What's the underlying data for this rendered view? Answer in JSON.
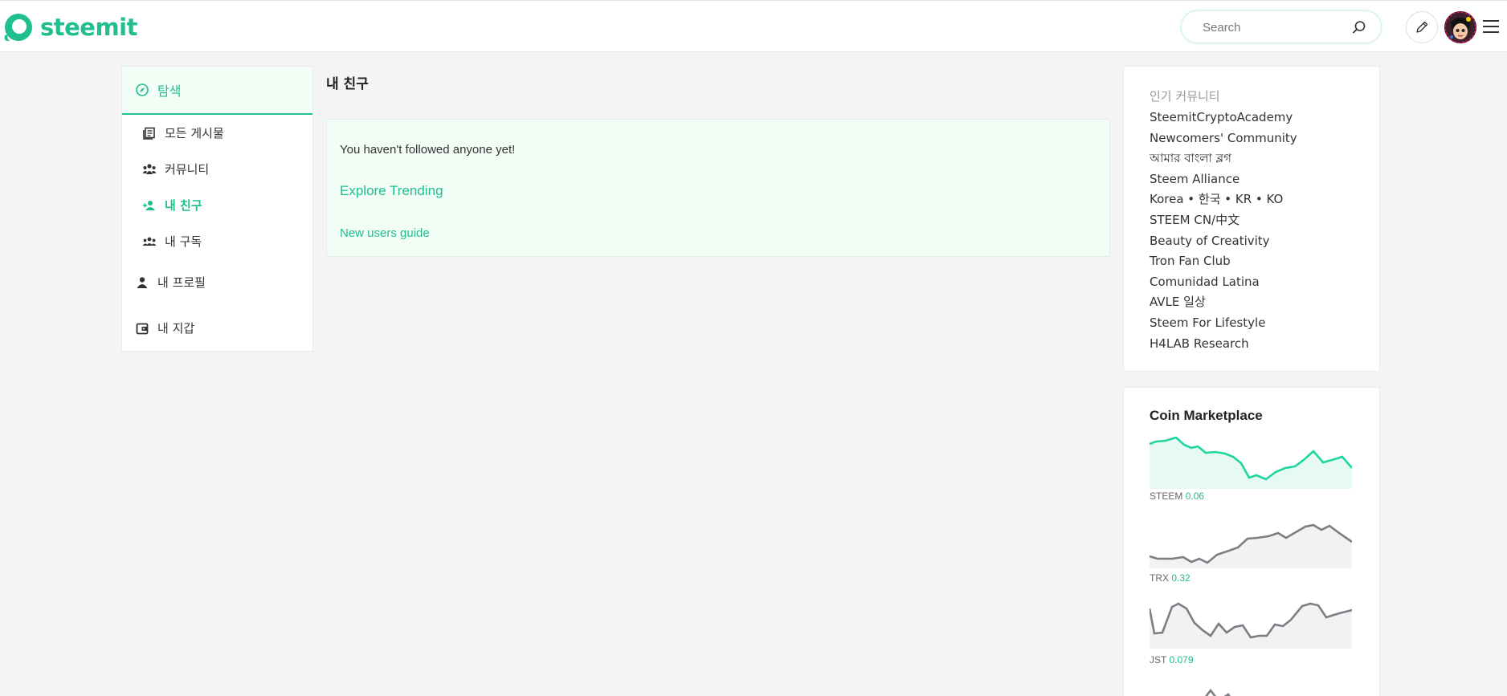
{
  "header": {
    "logo_text": "steemit",
    "search_placeholder": "Search"
  },
  "sidebar": {
    "explore": "탐색",
    "items": [
      {
        "label": "모든 게시물"
      },
      {
        "label": "커뮤니티"
      },
      {
        "label": "내 친구"
      },
      {
        "label": "내 구독"
      }
    ],
    "profile": "내 프로필",
    "wallet": "내 지갑"
  },
  "main": {
    "title": "내 친구",
    "empty_message": "You haven't followed anyone yet!",
    "explore_link": "Explore Trending",
    "guide_link": "New users guide"
  },
  "popular": {
    "heading": "인기 커뮤니티",
    "items": [
      "SteemitCryptoAcademy",
      "Newcomers' Community",
      "আমার বাংলা ব্লগ",
      "Steem Alliance",
      "Korea • 한국 • KR • KO",
      "STEEM CN/中文",
      "Beauty of Creativity",
      "Tron Fan Club",
      "Comunidad Latina",
      "AVLE 일상",
      "Steem For Lifestyle",
      "H4LAB Research"
    ]
  },
  "coins": {
    "heading": "Coin Marketplace",
    "list": [
      {
        "symbol": "STEEM",
        "price": "0.06",
        "color": "#1fd6a0"
      },
      {
        "symbol": "TRX",
        "price": "0.32",
        "color": "#7b7f85"
      },
      {
        "symbol": "JST",
        "price": "0.079",
        "color": "#7b7f85"
      }
    ]
  },
  "colors": {
    "accent": "#1fbf8f"
  }
}
